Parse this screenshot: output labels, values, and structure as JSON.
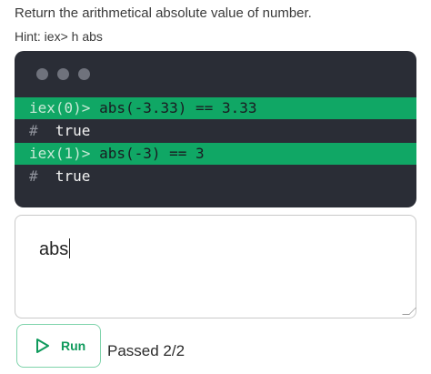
{
  "question": {
    "prompt": "Return the arithmetical absolute value of number.",
    "hint": "Hint: iex> h abs"
  },
  "terminal": {
    "lines": [
      {
        "kind": "input",
        "prompt": "iex(0)>",
        "code": "abs(-3.33) == 3.33"
      },
      {
        "kind": "output",
        "prefix": "#",
        "result": "true"
      },
      {
        "kind": "input",
        "prompt": "iex(1)>",
        "code": "abs(-3) == 3"
      },
      {
        "kind": "output",
        "prefix": "#",
        "result": "true"
      }
    ]
  },
  "editor": {
    "value": "abs"
  },
  "run_button": {
    "label": "Run",
    "icon": "play-icon"
  },
  "status": {
    "text": "Passed 2/2"
  },
  "colors": {
    "accent_green": "#10a765",
    "terminal_bg": "#2a2d36"
  }
}
